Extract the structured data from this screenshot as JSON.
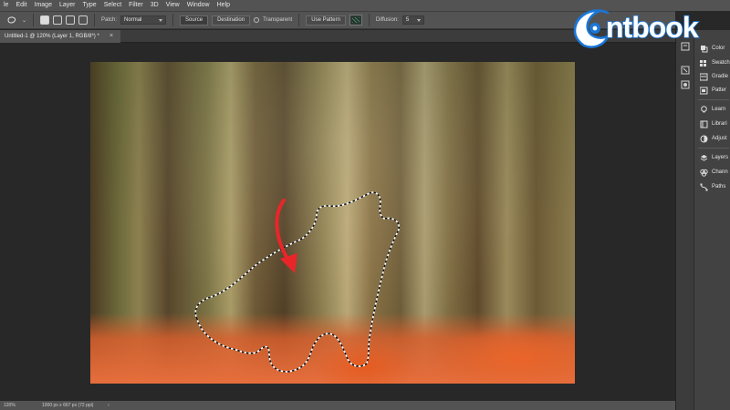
{
  "menubar": {
    "items": [
      "le",
      "Edit",
      "Image",
      "Layer",
      "Type",
      "Select",
      "Filter",
      "3D",
      "View",
      "Window",
      "Help"
    ]
  },
  "options": {
    "patch_label": "Patch:",
    "patch_value": "Normal",
    "source_label": "Source",
    "destination_label": "Destination",
    "transparent_label": "Transparent",
    "use_pattern_label": "Use Pattern",
    "diffusion_label": "Diffusion:",
    "diffusion_value": "5"
  },
  "document": {
    "tab_title": "Untitled-1 @ 120% (Layer 1, RGB/8*) *",
    "close_glyph": "×"
  },
  "status": {
    "zoom": "120%",
    "doc_info": "1000 px x 667 px (72 ppi)",
    "arrow": "›"
  },
  "panels": {
    "items": [
      "Color",
      "Swatch",
      "Gradie",
      "Patter",
      "Learn",
      "Librari",
      "Adjust",
      "Layers",
      "Chann",
      "Paths"
    ]
  },
  "logo": {
    "text": "ntbook"
  },
  "colors": {
    "accent_logo": "#1a77d8",
    "annotation_arrow": "#e8262a",
    "ui_panel": "#535353",
    "ui_dark": "#282828"
  }
}
